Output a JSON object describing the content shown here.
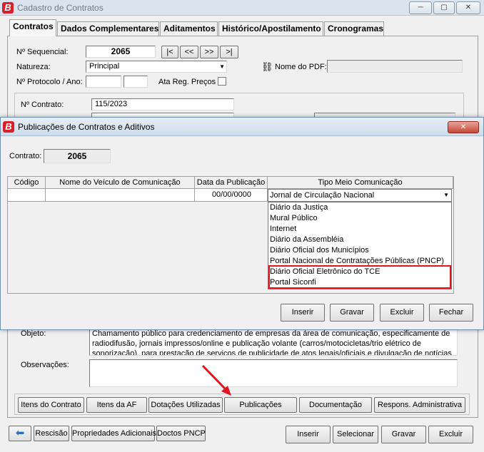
{
  "window": {
    "title": "Cadastro de Contratos",
    "minimize_glyph": "─",
    "restore_glyph": "▢",
    "close_glyph": "✕"
  },
  "tabs": [
    {
      "label": "Contratos",
      "active": true
    },
    {
      "label": "Dados Complementares"
    },
    {
      "label": "Aditamentos"
    },
    {
      "label": "Histórico/Apostilamento"
    },
    {
      "label": "Cronogramas"
    }
  ],
  "form": {
    "sequencial_label": "Nº Sequencial:",
    "sequencial_value": "2065",
    "nav": [
      "|<",
      "<<",
      ">>",
      ">|"
    ],
    "natureza_label": "Natureza:",
    "natureza_value": "Principal",
    "protocolo_label": "Nº Protocolo / Ano:",
    "ata_label": "Ata Reg. Preços",
    "pdf_label": "Nome do PDF:",
    "contrato_label": "Nº Contrato:",
    "contrato_value": "115/2023",
    "objeto_label": "Objeto:",
    "objeto_text": "Chamamento público para credenciamento de empresas da área de comunicação, especificamente de radiodifusão, jornais impressos/online e publicação volante (carros/motocicletas/trio elétrico de sonorização), para prestação de serviços de publicidade de atos legais/oficiais e divulgação de notícias de interesse",
    "observacoes_label": "Observações:"
  },
  "action_buttons": [
    "Itens do Contrato",
    "Itens da AF",
    "Dotações Utilizadas",
    "Publicações",
    "Documentação",
    "Respons. Administrativa"
  ],
  "footer_left_buttons": [
    "Rescisão",
    "Propriedades Adicionais",
    "Doctos PNCP"
  ],
  "footer_right_buttons": [
    "Inserir",
    "Selecionar",
    "Gravar",
    "Excluir"
  ],
  "dialog": {
    "title": "Publicações de Contratos e Aditivos",
    "contrato_label": "Contrato:",
    "contrato_value": "2065",
    "columns": [
      "Código",
      "Nome do Veículo de Comunicação",
      "Data da Publicação",
      "Tipo Meio Comunicação"
    ],
    "row": {
      "codigo": "",
      "nome": "",
      "data": "00/00/0000",
      "tipo": "Jornal de Circulação Nacional"
    },
    "dropdown_options": [
      "Diário da Justiça",
      "Mural Público",
      "Internet",
      "Diário da Assembléia",
      "Diário Oficial dos Municípios",
      "Portal Nacional de Contratações Públicas (PNCP)",
      "Diário Oficial Eletrônico do TCE",
      "Portal Siconfi"
    ],
    "highlight_color": "#e2141d",
    "buttons": [
      "Inserir",
      "Gravar",
      "Excluir",
      "Fechar"
    ],
    "close_glyph": "✕"
  },
  "annotation": {
    "arrow_color": "#e2141d"
  }
}
